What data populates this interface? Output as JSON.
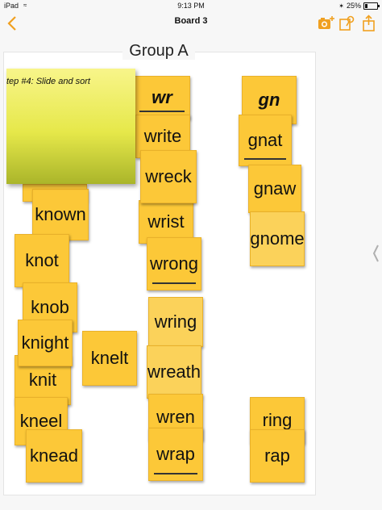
{
  "status_bar": {
    "device": "iPad",
    "time": "9:13 PM",
    "battery": "25%",
    "battery_level": 0.25
  },
  "nav": {
    "title": "Board 3",
    "back_icon": "chevron-left-icon",
    "icons": [
      "camera-add-icon",
      "pin-add-icon",
      "share-icon"
    ],
    "accent_color": "#f0a020"
  },
  "board": {
    "group_title": "Group A",
    "sticky_note": "tep #4:  Slide and sort"
  },
  "cards": {
    "known": "known",
    "knot": "knot",
    "knob": "knob",
    "knight": "knight",
    "knit": "knit",
    "kneel": "kneel",
    "knead": "knead",
    "knelt": "knelt",
    "wr": "wr",
    "write": "write",
    "wreck": "wreck",
    "wrist": "wrist",
    "wrong": "wrong",
    "wring": "wring",
    "wreath": "wreath",
    "wren": "wren",
    "wrap": "wrap",
    "gn": "gn",
    "gnat": "gnat",
    "gnaw": "gnaw",
    "gnome": "gnome",
    "ring": "ring",
    "rap": "rap"
  },
  "colors": {
    "card": "#fcc838",
    "sticky": "#e6e84a"
  }
}
